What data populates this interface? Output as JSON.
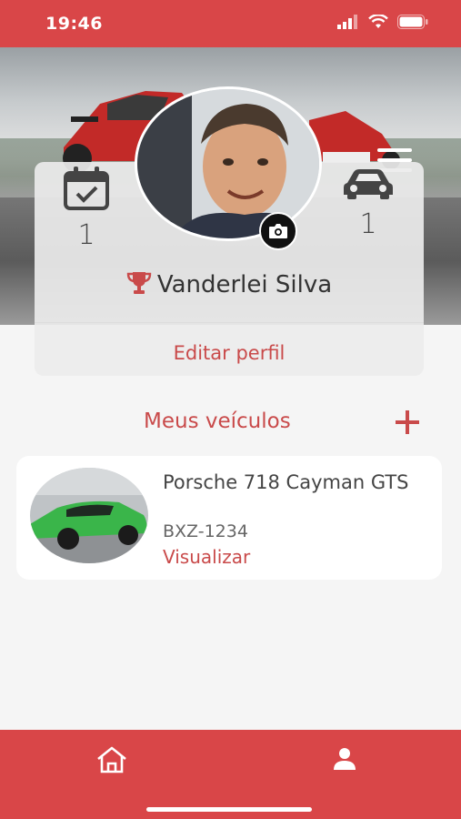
{
  "status": {
    "time": "19:46"
  },
  "profile": {
    "agenda_count": "1",
    "vehicle_count": "1",
    "name": "Vanderlei Silva",
    "edit_label": "Editar perfil"
  },
  "vehicles_section": {
    "title": "Meus veículos"
  },
  "vehicles": [
    {
      "name": "Porsche 718 Cayman GTS",
      "plate": "BXZ-1234",
      "action": "Visualizar"
    }
  ],
  "icons": {
    "menu": "hamburger-icon",
    "calendar": "calendar-check-icon",
    "car": "car-icon",
    "trophy": "trophy-icon",
    "camera": "camera-icon",
    "add": "plus-icon",
    "home": "home-icon",
    "profile": "user-icon"
  },
  "colors": {
    "brand": "#d94648",
    "accent_text": "#c94a4a"
  }
}
